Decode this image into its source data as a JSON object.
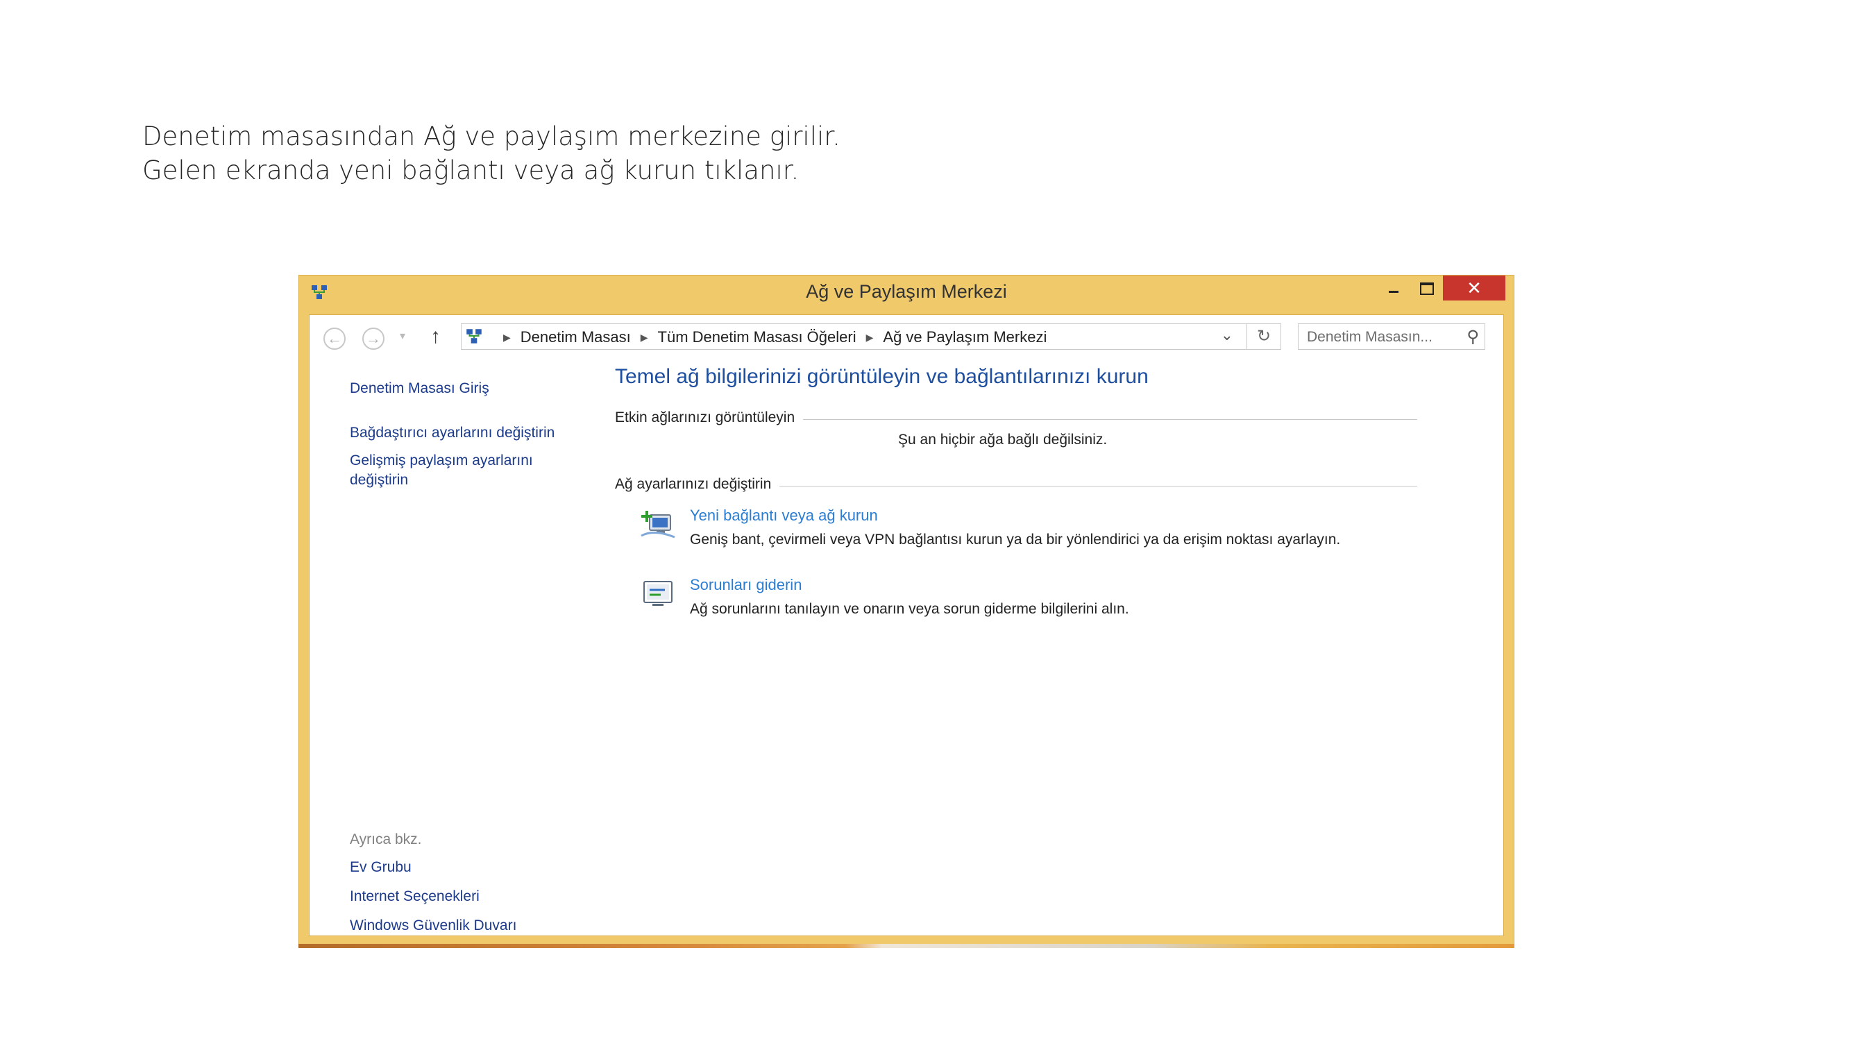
{
  "slide": {
    "line1": "Denetim masasından Ağ ve paylaşım merkezine girilir.",
    "line2": "Gelen ekranda yeni bağlantı veya ağ kurun tıklanır."
  },
  "window": {
    "title": "Ağ ve Paylaşım Merkezi",
    "frame_color": "#f0c96a",
    "close_color": "#c7352d",
    "close_glyph": "✕"
  },
  "navbar": {
    "breadcrumbs": [
      "Denetim Masası",
      "Tüm Denetim Masası Öğeleri",
      "Ağ ve Paylaşım Merkezi"
    ],
    "search_placeholder": "Denetim Masasın..."
  },
  "sidebar": {
    "home": "Denetim Masası Giriş",
    "adapter": "Bağdaştırıcı ayarlarını değiştirin",
    "sharing": "Gelişmiş paylaşım ayarlarını değiştirin",
    "see_also_title": "Ayrıca bkz.",
    "see_also": [
      "Ev Grubu",
      "Internet Seçenekleri",
      "Windows Güvenlik Duvarı"
    ]
  },
  "main": {
    "title": "Temel ağ bilgilerinizi görüntüleyin ve bağlantılarınızı kurun",
    "active_networks_label": "Etkin ağlarınızı görüntüleyin",
    "not_connected": "Şu an hiçbir ağa bağlı değilsiniz.",
    "change_settings_label": "Ağ ayarlarınızı değiştirin",
    "tasks": [
      {
        "icon": "new-connection-icon",
        "link": "Yeni bağlantı veya ağ kurun",
        "desc": "Geniş bant, çevirmeli veya VPN bağlantısı kurun ya da bir yönlendirici ya da erişim noktası ayarlayın."
      },
      {
        "icon": "troubleshoot-icon",
        "link": "Sorunları giderin",
        "desc": "Ağ sorunlarını tanılayın ve onarın veya sorun giderme bilgilerini alın."
      }
    ]
  }
}
